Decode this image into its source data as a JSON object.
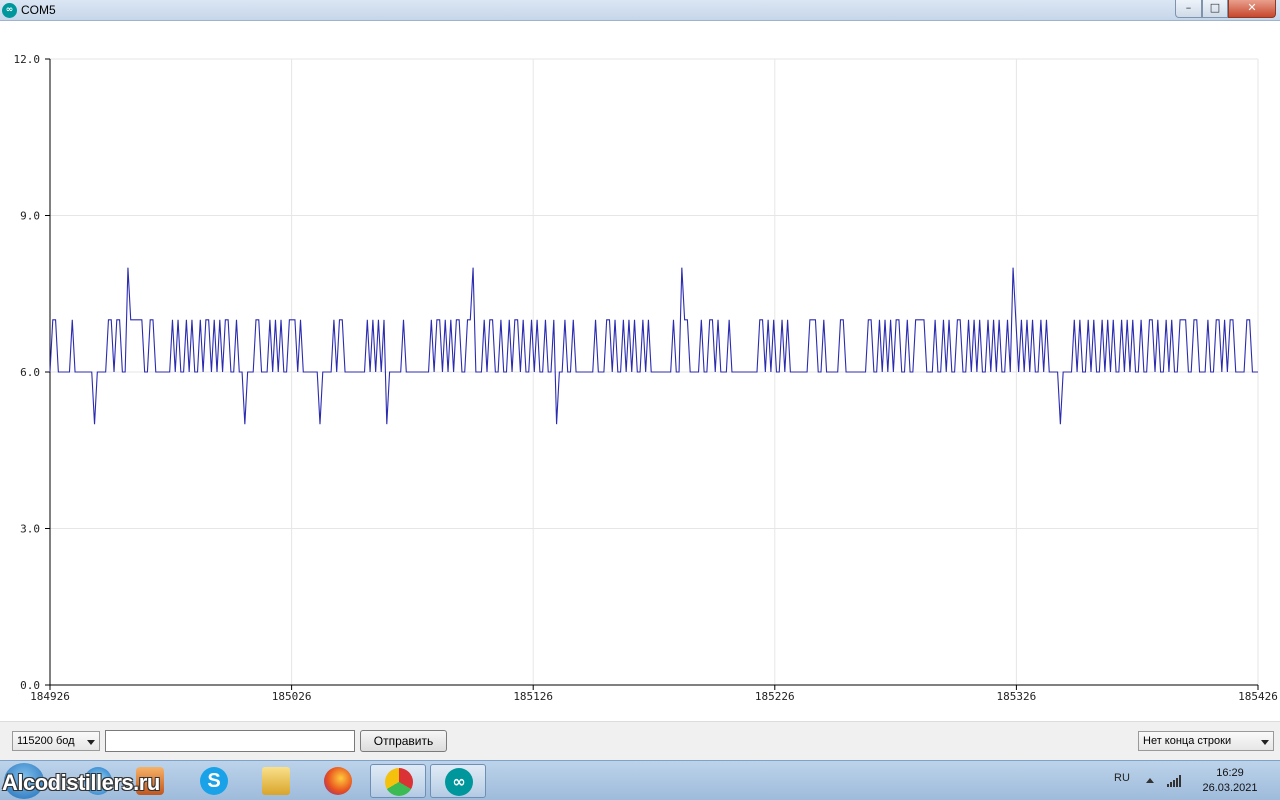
{
  "window": {
    "title": "COM5",
    "app_icon": "arduino-icon",
    "buttons": {
      "minimize": "–",
      "maximize": "□",
      "close": "✕"
    }
  },
  "chart_data": {
    "type": "line",
    "title": "",
    "xlabel": "",
    "ylabel": "",
    "xlim": [
      184926,
      185426
    ],
    "ylim": [
      0,
      12
    ],
    "x_ticks": [
      "184926",
      "185026",
      "185126",
      "185226",
      "185326",
      "185426"
    ],
    "y_ticks": [
      "0.0",
      "3.0",
      "6.0",
      "9.0",
      "12.0"
    ],
    "grid": true,
    "series": [
      {
        "color": "#2b2bb0",
        "y": [
          6,
          7,
          7,
          6,
          6,
          6,
          6,
          6,
          7,
          6,
          6,
          6,
          6,
          6,
          6,
          6,
          5,
          6,
          6,
          6,
          6,
          7,
          7,
          6,
          7,
          7,
          6,
          6,
          8,
          7,
          7,
          7,
          7,
          7,
          6,
          6,
          7,
          7,
          6,
          6,
          6,
          6,
          6,
          6,
          7,
          6,
          7,
          6,
          6,
          7,
          6,
          7,
          6,
          6,
          7,
          6,
          7,
          7,
          6,
          7,
          6,
          7,
          6,
          7,
          7,
          6,
          6,
          7,
          6,
          6,
          5,
          6,
          6,
          6,
          7,
          7,
          6,
          6,
          6,
          7,
          6,
          7,
          6,
          7,
          6,
          6,
          7,
          7,
          7,
          6,
          7,
          6,
          6,
          6,
          6,
          6,
          6,
          5,
          6,
          6,
          6,
          6,
          7,
          6,
          7,
          7,
          6,
          6,
          6,
          6,
          6,
          6,
          6,
          6,
          7,
          6,
          7,
          6,
          7,
          6,
          7,
          5,
          6,
          6,
          6,
          6,
          6,
          7,
          6,
          6,
          6,
          6,
          6,
          6,
          6,
          6,
          6,
          7,
          6,
          7,
          7,
          6,
          7,
          6,
          7,
          6,
          7,
          7,
          6,
          6,
          7,
          7,
          8,
          6,
          6,
          6,
          7,
          6,
          7,
          7,
          6,
          6,
          7,
          6,
          6,
          7,
          6,
          7,
          7,
          6,
          7,
          6,
          6,
          7,
          6,
          7,
          6,
          6,
          7,
          6,
          6,
          7,
          5,
          6,
          6,
          7,
          6,
          6,
          7,
          6,
          6,
          6,
          6,
          6,
          6,
          6,
          7,
          6,
          6,
          6,
          7,
          7,
          6,
          7,
          6,
          6,
          7,
          6,
          7,
          6,
          7,
          6,
          6,
          7,
          6,
          7,
          6,
          6,
          6,
          6,
          6,
          6,
          6,
          6,
          7,
          6,
          6,
          8,
          7,
          7,
          6,
          6,
          6,
          6,
          7,
          6,
          6,
          7,
          7,
          6,
          7,
          6,
          6,
          6,
          7,
          6,
          6,
          6,
          6,
          6,
          6,
          6,
          6,
          6,
          6,
          7,
          7,
          6,
          7,
          6,
          7,
          6,
          6,
          7,
          6,
          7,
          6,
          6,
          6,
          6,
          6,
          6,
          6,
          7,
          7,
          7,
          6,
          6,
          7,
          6,
          6,
          6,
          6,
          6,
          7,
          7,
          6,
          6,
          6,
          6,
          6,
          6,
          6,
          6,
          7,
          7,
          6,
          6,
          7,
          6,
          7,
          6,
          7,
          6,
          7,
          7,
          6,
          6,
          7,
          6,
          6,
          7,
          7,
          7,
          7,
          6,
          6,
          6,
          7,
          6,
          6,
          7,
          6,
          7,
          6,
          6,
          7,
          7,
          6,
          6,
          7,
          6,
          7,
          6,
          7,
          6,
          6,
          7,
          6,
          7,
          6,
          7,
          6,
          6,
          7,
          6,
          8,
          7,
          6,
          7,
          6,
          7,
          6,
          7,
          6,
          6,
          7,
          6,
          7,
          6,
          6,
          6,
          6,
          5,
          6,
          6,
          6,
          6,
          7,
          6,
          7,
          6,
          6,
          7,
          6,
          7,
          6,
          6,
          7,
          6,
          7,
          6,
          7,
          6,
          6,
          7,
          6,
          7,
          6,
          7,
          6,
          6,
          7,
          6,
          6,
          7,
          7,
          6,
          7,
          6,
          6,
          7,
          6,
          7,
          6,
          6,
          7,
          7,
          7,
          6,
          6,
          7,
          7,
          6,
          6,
          6,
          7,
          6,
          6,
          7,
          7,
          6,
          7,
          6,
          7,
          7,
          6,
          6,
          6,
          6,
          7,
          7,
          6,
          6,
          6
        ]
      }
    ]
  },
  "controls": {
    "baud": "115200 бод",
    "input_value": "",
    "send_label": "Отправить",
    "line_ending": "Нет конца строки"
  },
  "taskbar": {
    "watermark": "Alcodistillers.ru",
    "language": "RU",
    "time": "16:29",
    "date": "26.03.2021"
  },
  "colors": {
    "plot_line": "#2b2bb0",
    "grid": "#e6e6e6",
    "axis": "#000000"
  }
}
